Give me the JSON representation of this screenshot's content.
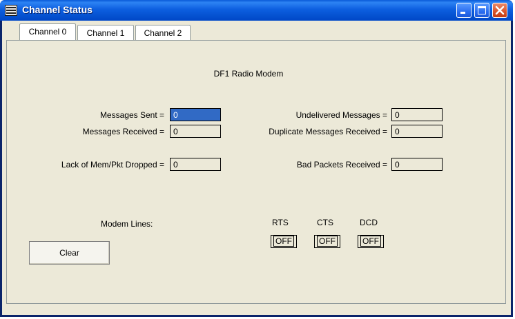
{
  "window": {
    "title": "Channel Status",
    "controls": [
      "minimize-icon",
      "maximize-icon",
      "close-icon"
    ]
  },
  "tabs": [
    {
      "label": "Channel 0"
    },
    {
      "label": "Channel 1"
    },
    {
      "label": "Channel 2"
    }
  ],
  "panel": {
    "heading": "DF1 Radio Modem",
    "stats": {
      "messages_sent": {
        "label": "Messages Sent =",
        "value": "0"
      },
      "messages_received": {
        "label": "Messages Received =",
        "value": "0"
      },
      "lack_of_mem": {
        "label": "Lack of Mem/Pkt Dropped =",
        "value": "0"
      },
      "undelivered": {
        "label": "Undelivered Messages =",
        "value": "0"
      },
      "duplicate": {
        "label": "Duplicate Messages Received =",
        "value": "0"
      },
      "bad_packets": {
        "label": "Bad Packets Received =",
        "value": "0"
      }
    },
    "modem_lines": {
      "label": "Modem Lines:",
      "rts": {
        "label": "RTS",
        "value": "OFF"
      },
      "cts": {
        "label": "CTS",
        "value": "OFF"
      },
      "dcd": {
        "label": "DCD",
        "value": "OFF"
      }
    },
    "clear_button": "Clear"
  }
}
